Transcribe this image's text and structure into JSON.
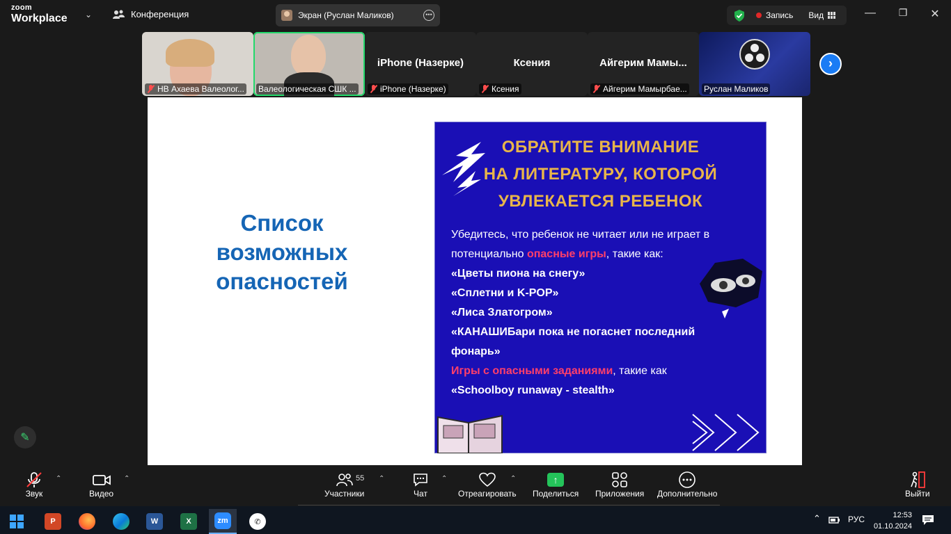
{
  "app": {
    "logo_top": "zoom",
    "logo_bottom": "Workplace",
    "conference_label": "Конференция",
    "sharing_label": "Экран (Руслан Маликов)",
    "record_label": "Запись",
    "view_label": "Вид"
  },
  "participants": [
    {
      "display": "",
      "label": "НВ Ахаева Валеолог...",
      "muted": true
    },
    {
      "display": "",
      "label": "Валеологическая СШК ...",
      "muted": false
    },
    {
      "display": "iPhone (Назерке)",
      "label": "iPhone (Назерке)",
      "muted": true
    },
    {
      "display": "Ксения",
      "label": "Ксения",
      "muted": true
    },
    {
      "display": "Айгерим  Мамы...",
      "label": "Айгерим Мамырбае...",
      "muted": true
    },
    {
      "display": "",
      "label": "Руслан Маликов",
      "muted": false
    }
  ],
  "slide": {
    "title_lines": [
      "Список",
      "возможных",
      "опасностей"
    ],
    "poster_heading": [
      "ОБРАТИТЕ ВНИМАНИЕ",
      "НА ЛИТЕРАТУРУ, КОТОРОЙ",
      "УВЛЕКАЕТСЯ РЕБЕНОК"
    ],
    "intro_1": "Убедитесь, что ребенок не читает или не играет в",
    "intro_2a": "потенциально ",
    "intro_2_hl": "опасные игры",
    "intro_2b": ", такие как:",
    "items": [
      "«Цветы пиона на снегу»",
      "«Сплетни и K-POP»",
      "«Лиса Златогром»",
      "«КАНАШИБари пока не погаснет последний",
      "фонарь»"
    ],
    "games_hl": "Игры с опасными заданиями",
    "games_tail": ", такие как",
    "games_item": "«Schoolboy runaway - stealth»",
    "heading_color": "#e8b54a",
    "highlight_color": "#ff3f6a",
    "poster_bg": "#1a0fb5",
    "title_color": "#1565b5"
  },
  "toolbar": {
    "audio": "Звук",
    "video": "Видео",
    "participants": "Участники",
    "participants_count": "55",
    "chat": "Чат",
    "react": "Отреагировать",
    "share": "Поделиться",
    "apps": "Приложения",
    "more": "Дополнительно",
    "leave": "Выйти"
  },
  "taskbar": {
    "apps": [
      "start",
      "powerpoint",
      "firefox",
      "edge",
      "word",
      "excel",
      "zoom",
      "whatsapp"
    ],
    "lang": "РУС",
    "time": "12:53",
    "date": "01.10.2024"
  }
}
